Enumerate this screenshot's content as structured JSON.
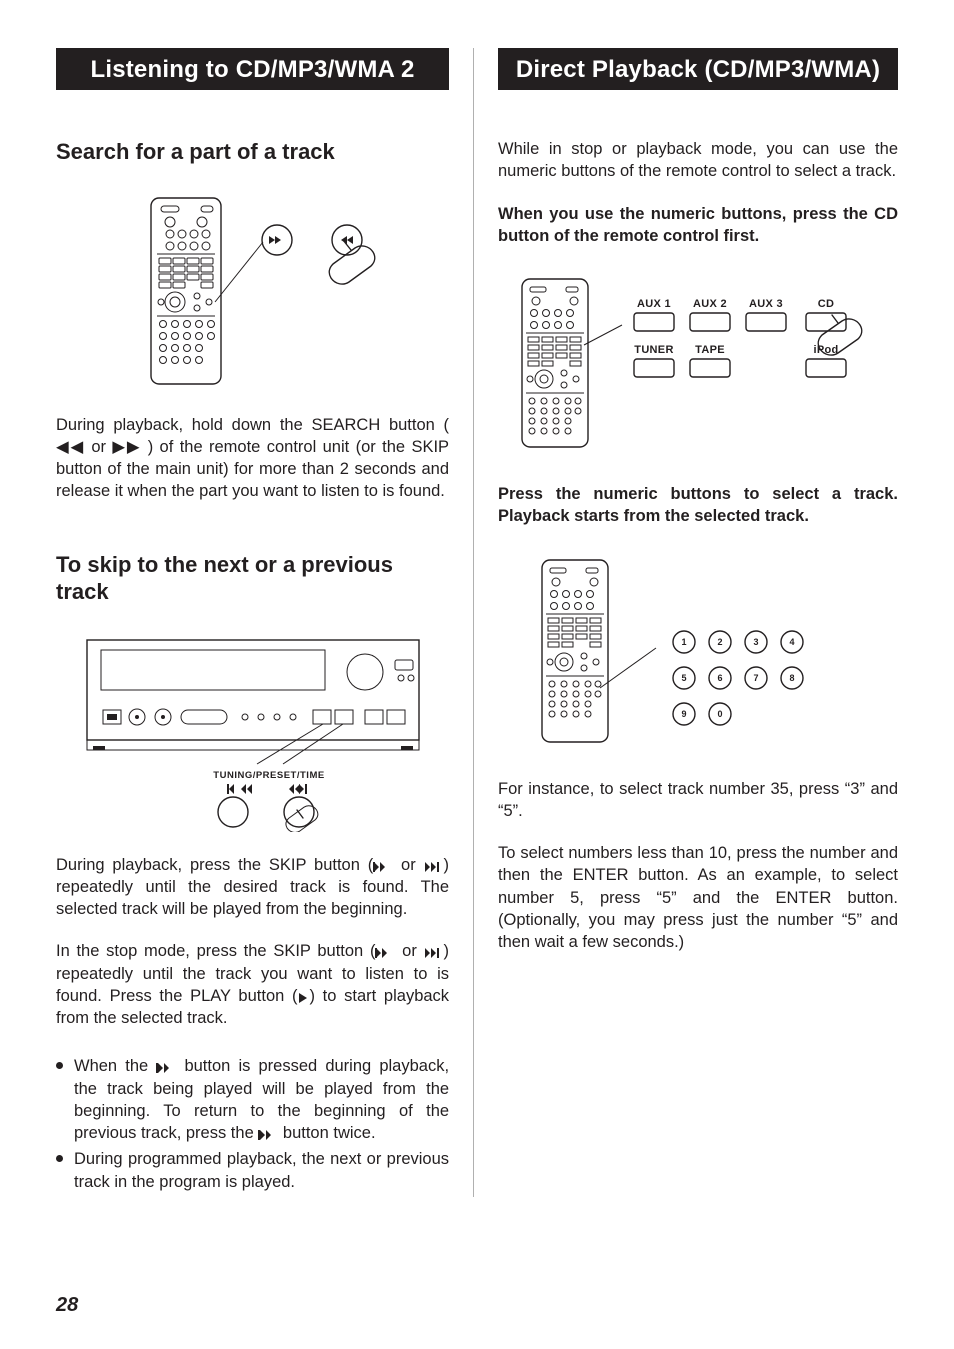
{
  "page_number": "28",
  "left": {
    "headband": "Listening to CD/MP3/WMA 2",
    "search": {
      "heading": "Search for a part of a track",
      "para": "During playback, hold down the SEARCH button ( ◀◀ or ▶▶ ) of the remote control unit (or the SKIP button of the main unit) for more than 2 seconds and release it when the part you want to listen to is found."
    },
    "skip": {
      "heading": "To skip to the next or a previous track",
      "tuning_label": "TUNING/PRESET/TIME",
      "para1_a": "During playback, press the SKIP button (",
      "para1_b": " or ",
      "para1_c": ") repeatedly until the desired track is found. The selected track will be played from the beginning.",
      "para2_a": "In the stop mode, press the SKIP button (",
      "para2_b": " or ",
      "para2_c": ") repeatedly until the track you want to listen to is found. Press the PLAY button (",
      "para2_d": ") to start playback from the selected track.",
      "bullet1_a": "When the ",
      "bullet1_b": " button is pressed during playback, the track being played will be played from the beginning. To return to the beginning of the previous track, press the ",
      "bullet1_c": " button twice.",
      "bullet2": "During programmed playback, the next or previous track in the program is played."
    }
  },
  "right": {
    "headband": "Direct Playback (CD/MP3/WMA)",
    "intro": "While in stop or playback mode, you can use the numeric buttons of the remote control to select a track.",
    "note1": "When you use the numeric buttons, press the CD button of the remote control first.",
    "source_buttons": {
      "row1": [
        "AUX 1",
        "AUX 2",
        "AUX 3",
        "CD"
      ],
      "row2": [
        "TUNER",
        "TAPE",
        "",
        "iPod"
      ]
    },
    "note2": "Press the numeric buttons to select a track. Playback starts from the selected track.",
    "numpad": [
      "1",
      "2",
      "3",
      "4",
      "5",
      "6",
      "7",
      "8",
      "9",
      "0"
    ],
    "example": "For instance, to select track number 35, press “3” and “5”.",
    "less10": "To select numbers less than 10, press the number and then the ENTER button. As an example, to select number 5, press “5” and the ENTER button. (Optionally, you may press just the number “5” and then wait a few seconds.)"
  }
}
